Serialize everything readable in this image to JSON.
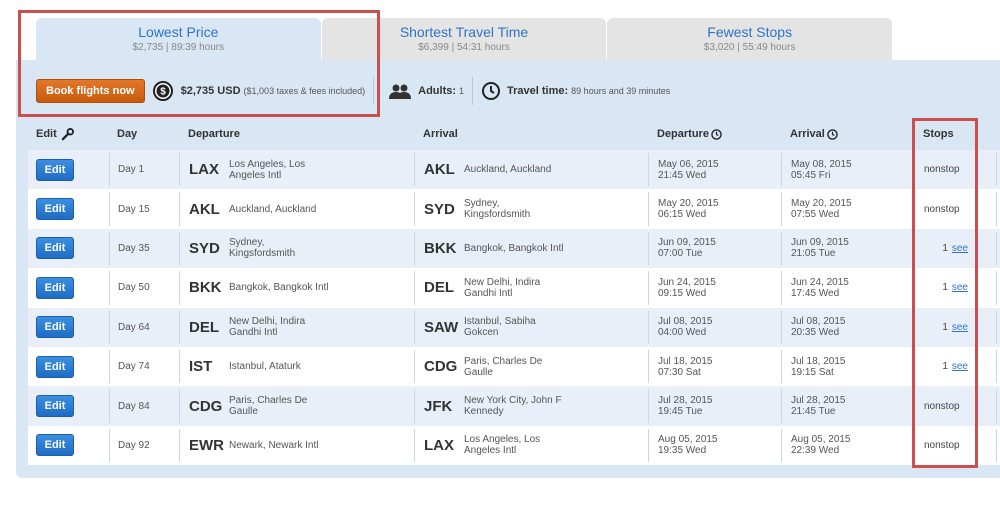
{
  "tabs": [
    {
      "title": "Lowest Price",
      "sub": "$2,735 | 89:39 hours"
    },
    {
      "title": "Shortest Travel Time",
      "sub": "$6,399 | 54:31 hours"
    },
    {
      "title": "Fewest Stops",
      "sub": "$3,020 | 55:49 hours"
    }
  ],
  "summary": {
    "book_label": "Book flights now",
    "price": "$2,735 USD",
    "price_note": "($1,003 taxes & fees included)",
    "adults_label": "Adults:",
    "adults_value": "1",
    "travel_label": "Travel time:",
    "travel_value": "89 hours and 39 minutes"
  },
  "headers": {
    "edit": "Edit",
    "day": "Day",
    "departure": "Departure",
    "arrival": "Arrival",
    "departure_time": "Departure",
    "arrival_time": "Arrival",
    "stops": "Stops"
  },
  "edit_label": "Edit",
  "see_label": "see",
  "rows": [
    {
      "day": "Day 1",
      "dep_code": "LAX",
      "dep_name": "Los Angeles, Los Angeles Intl",
      "arr_code": "AKL",
      "arr_name": "Auckland, Auckland",
      "dep_date": "May 06, 2015",
      "dep_time": "21:45 Wed",
      "arr_date": "May 08, 2015",
      "arr_time": "05:45 Fri",
      "stops": "nonstop"
    },
    {
      "day": "Day 15",
      "dep_code": "AKL",
      "dep_name": "Auckland, Auckland",
      "arr_code": "SYD",
      "arr_name": "Sydney, Kingsfordsmith",
      "dep_date": "May 20, 2015",
      "dep_time": "06:15 Wed",
      "arr_date": "May 20, 2015",
      "arr_time": "07:55 Wed",
      "stops": "nonstop"
    },
    {
      "day": "Day 35",
      "dep_code": "SYD",
      "dep_name": "Sydney, Kingsfordsmith",
      "arr_code": "BKK",
      "arr_name": "Bangkok, Bangkok Intl",
      "dep_date": "Jun 09, 2015",
      "dep_time": "07:00 Tue",
      "arr_date": "Jun 09, 2015",
      "arr_time": "21:05 Tue",
      "stops": "1"
    },
    {
      "day": "Day 50",
      "dep_code": "BKK",
      "dep_name": "Bangkok, Bangkok Intl",
      "arr_code": "DEL",
      "arr_name": "New Delhi, Indira Gandhi Intl",
      "dep_date": "Jun 24, 2015",
      "dep_time": "09:15 Wed",
      "arr_date": "Jun 24, 2015",
      "arr_time": "17:45 Wed",
      "stops": "1"
    },
    {
      "day": "Day 64",
      "dep_code": "DEL",
      "dep_name": "New Delhi, Indira Gandhi Intl",
      "arr_code": "SAW",
      "arr_name": "Istanbul, Sabiha Gokcen",
      "dep_date": "Jul 08, 2015",
      "dep_time": "04:00 Wed",
      "arr_date": "Jul 08, 2015",
      "arr_time": "20:35 Wed",
      "stops": "1"
    },
    {
      "day": "Day 74",
      "dep_code": "IST",
      "dep_name": "Istanbul, Ataturk",
      "arr_code": "CDG",
      "arr_name": "Paris, Charles De Gaulle",
      "dep_date": "Jul 18, 2015",
      "dep_time": "07:30 Sat",
      "arr_date": "Jul 18, 2015",
      "arr_time": "19:15 Sat",
      "stops": "1"
    },
    {
      "day": "Day 84",
      "dep_code": "CDG",
      "dep_name": "Paris, Charles De Gaulle",
      "arr_code": "JFK",
      "arr_name": "New York City, John F Kennedy",
      "dep_date": "Jul 28, 2015",
      "dep_time": "19:45 Tue",
      "arr_date": "Jul 28, 2015",
      "arr_time": "21:45 Tue",
      "stops": "nonstop"
    },
    {
      "day": "Day 92",
      "dep_code": "EWR",
      "dep_name": "Newark, Newark Intl",
      "arr_code": "LAX",
      "arr_name": "Los Angeles, Los Angeles Intl",
      "dep_date": "Aug 05, 2015",
      "dep_time": "19:35 Wed",
      "arr_date": "Aug 05, 2015",
      "arr_time": "22:39 Wed",
      "stops": "nonstop"
    }
  ],
  "colors": {
    "accent": "#2f74c6",
    "book_button": "#d4650f",
    "edit_button": "#2a7ad4",
    "panel": "#d9e6f4",
    "highlight": "#c9504f"
  }
}
